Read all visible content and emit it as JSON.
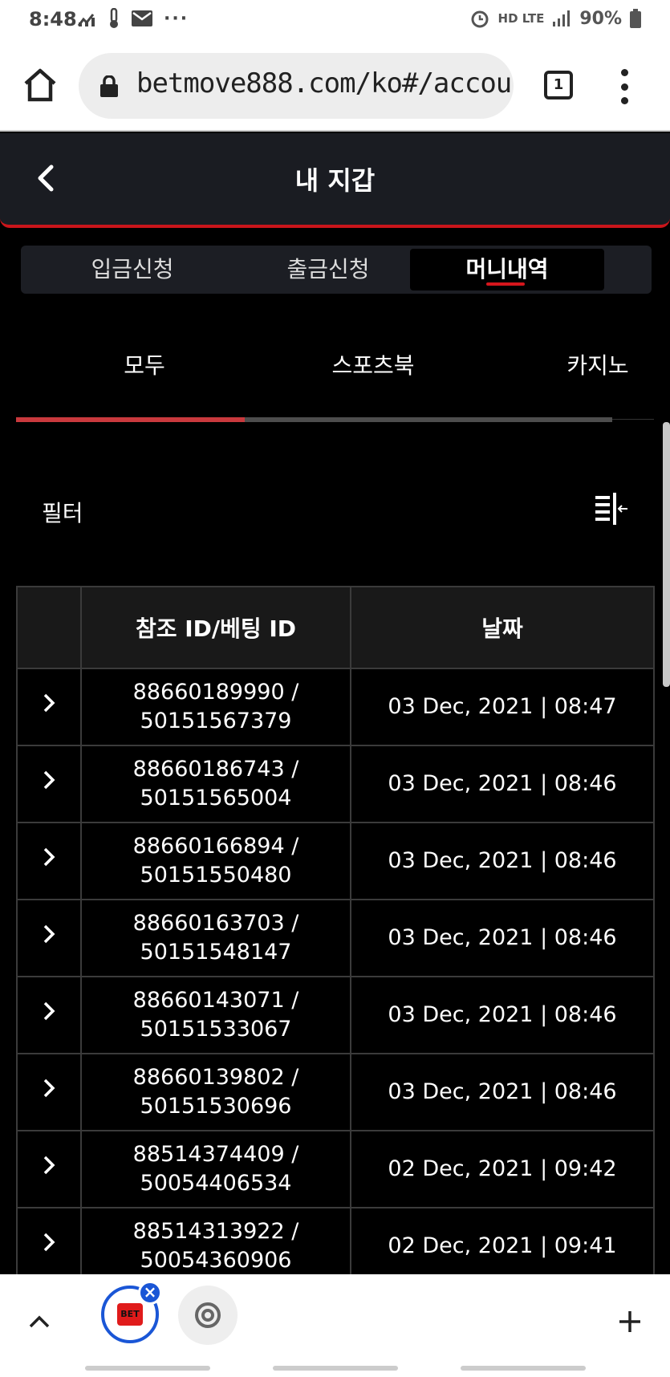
{
  "status_bar": {
    "time": "8:48",
    "network": "HD LTE",
    "battery": "90%"
  },
  "browser": {
    "url": "betmove888.com/ko#/accoun",
    "tab_count": "1"
  },
  "header": {
    "title": "내 지갑"
  },
  "tabs": [
    {
      "label": "입금신청",
      "active": false
    },
    {
      "label": "출금신청",
      "active": false
    },
    {
      "label": "머니내역",
      "active": true
    }
  ],
  "subtabs": [
    {
      "label": "모두",
      "active": true
    },
    {
      "label": "스포츠북",
      "active": false
    },
    {
      "label": "카지노",
      "active": false
    }
  ],
  "filter": {
    "label": "필터"
  },
  "table": {
    "headers": [
      "",
      "참조 ID/베팅 ID",
      "날짜"
    ],
    "rows": [
      {
        "ref": "88660189990 /",
        "bet": "50151567379",
        "date": "03 Dec, 2021 | 08:47"
      },
      {
        "ref": "88660186743 /",
        "bet": "50151565004",
        "date": "03 Dec, 2021 | 08:46"
      },
      {
        "ref": "88660166894 /",
        "bet": "50151550480",
        "date": "03 Dec, 2021 | 08:46"
      },
      {
        "ref": "88660163703 /",
        "bet": "50151548147",
        "date": "03 Dec, 2021 | 08:46"
      },
      {
        "ref": "88660143071 /",
        "bet": "50151533067",
        "date": "03 Dec, 2021 | 08:46"
      },
      {
        "ref": "88660139802 /",
        "bet": "50151530696",
        "date": "03 Dec, 2021 | 08:46"
      },
      {
        "ref": "88514374409 /",
        "bet": "50054406534",
        "date": "02 Dec, 2021 | 09:42"
      },
      {
        "ref": "88514313922 /",
        "bet": "50054360906",
        "date": "02 Dec, 2021 | 09:41"
      }
    ]
  },
  "bottom_bar": {
    "app_badge": "BET"
  },
  "colors": {
    "accent": "#c9151b",
    "panel": "#1a1c22",
    "background": "#000000"
  }
}
